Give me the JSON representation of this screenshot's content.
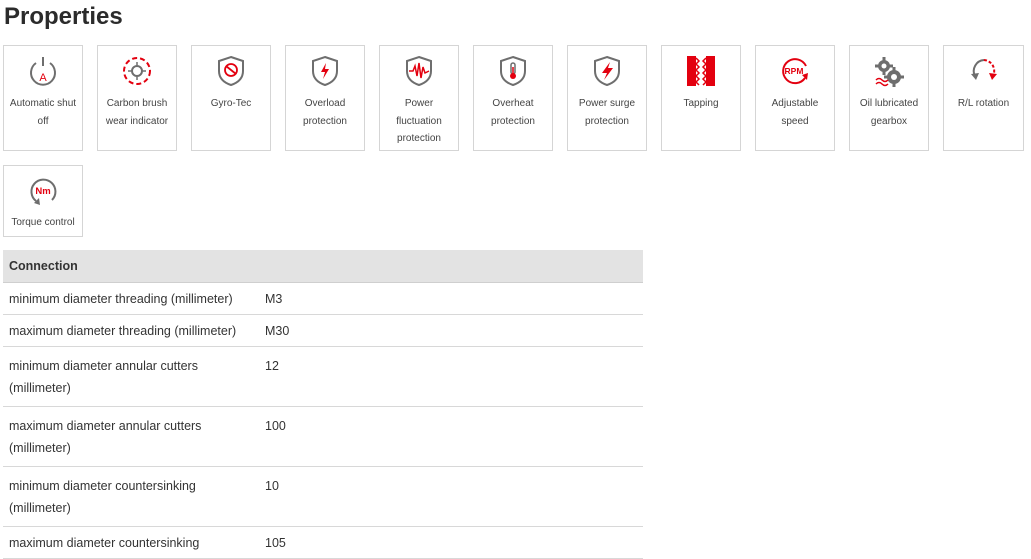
{
  "page": {
    "title": "Properties"
  },
  "properties": [
    {
      "label": "Automatic shut off",
      "icon": "automatic-shutoff-icon"
    },
    {
      "label": "Carbon brush wear indicator",
      "icon": "carbon-brush-icon"
    },
    {
      "label": "Gyro-Tec",
      "icon": "gyro-tec-icon"
    },
    {
      "label": "Overload protection",
      "icon": "overload-protection-icon"
    },
    {
      "label": "Power fluctuation protection",
      "icon": "power-fluctuation-icon"
    },
    {
      "label": "Overheat protection",
      "icon": "overheat-protection-icon"
    },
    {
      "label": "Power surge protection",
      "icon": "power-surge-icon"
    },
    {
      "label": "Tapping",
      "icon": "tapping-icon"
    },
    {
      "label": "Adjustable speed",
      "icon": "adjustable-speed-icon",
      "icon_text": "RPM"
    },
    {
      "label": "Oil lubricated gearbox",
      "icon": "gearbox-icon"
    },
    {
      "label": "R/L rotation",
      "icon": "rotation-icon"
    },
    {
      "label": "Torque control",
      "icon": "torque-control-icon",
      "icon_text": "Nm"
    }
  ],
  "colors": {
    "accent": "#e3000f",
    "icon_gray": "#6e6e6e",
    "header_bg": "#e3e3e3"
  },
  "table": {
    "section": "Connection",
    "rows": [
      {
        "key": "minimum diameter threading (millimeter)",
        "value": "M3"
      },
      {
        "key": "maximum diameter threading (millimeter)",
        "value": "M30"
      },
      {
        "key": "minimum diameter annular cutters (millimeter)",
        "value": "12"
      },
      {
        "key": "maximum diameter annular cutters (millimeter)",
        "value": "100"
      },
      {
        "key": "minimum diameter countersinking (millimeter)",
        "value": "10"
      },
      {
        "key": "maximum diameter countersinking",
        "value": "105"
      }
    ]
  }
}
